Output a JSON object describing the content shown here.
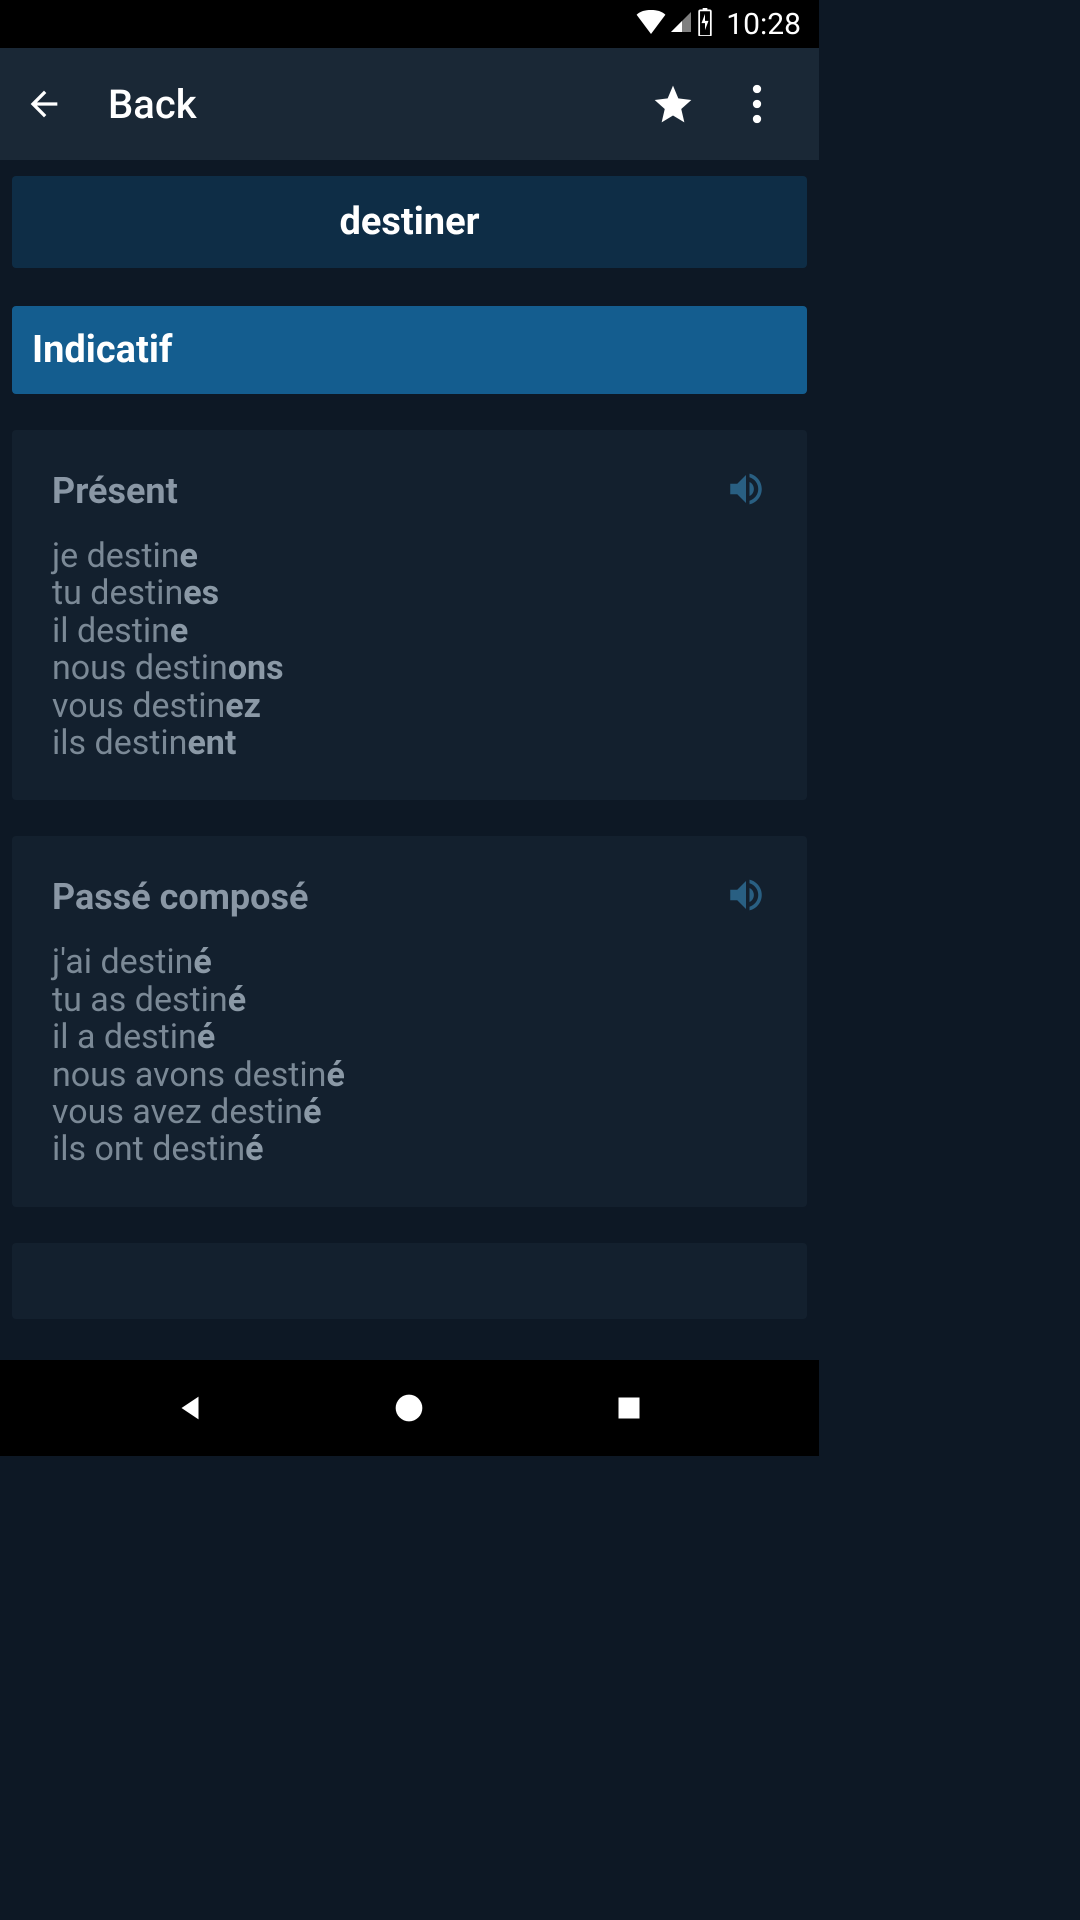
{
  "status": {
    "time": "10:28"
  },
  "appbar": {
    "title": "Back"
  },
  "verb": "destiner",
  "mood": "Indicatif",
  "tenses": [
    {
      "title": "Présent",
      "lines": [
        {
          "base": "je destin",
          "suffix": "e"
        },
        {
          "base": "tu destin",
          "suffix": "es"
        },
        {
          "base": "il destin",
          "suffix": "e"
        },
        {
          "base": "nous destin",
          "suffix": "ons"
        },
        {
          "base": "vous destin",
          "suffix": "ez"
        },
        {
          "base": "ils destin",
          "suffix": "ent"
        }
      ]
    },
    {
      "title": "Passé composé",
      "lines": [
        {
          "base": "j'ai destin",
          "suffix": "é"
        },
        {
          "base": "tu as destin",
          "suffix": "é"
        },
        {
          "base": "il a destin",
          "suffix": "é"
        },
        {
          "base": "nous avons destin",
          "suffix": "é"
        },
        {
          "base": "vous avez destin",
          "suffix": "é"
        },
        {
          "base": "ils ont destin",
          "suffix": "é"
        }
      ]
    }
  ]
}
